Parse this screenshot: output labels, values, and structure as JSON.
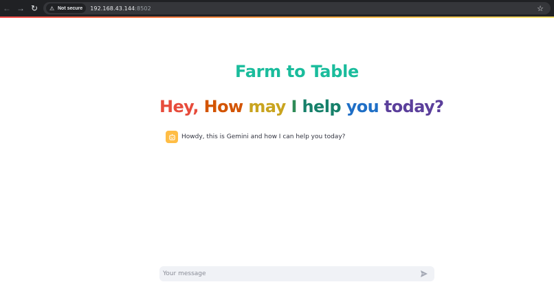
{
  "browser": {
    "back_icon": "arrow-left-icon",
    "forward_icon": "arrow-right-icon",
    "reload_icon": "reload-icon",
    "security_label": "Not secure",
    "url_host": "192.168.43.144",
    "url_port": ":8502",
    "bookmark_icon": "star-icon"
  },
  "app": {
    "title": "Farm to Table",
    "title_color": "#1abc9c",
    "headline_words": [
      {
        "text": "Hey,",
        "color": "#e74c3c"
      },
      {
        "text": "How",
        "color": "#d35400"
      },
      {
        "text": "may",
        "color": "#c9a41f"
      },
      {
        "text": "I",
        "color": "#2e8b57"
      },
      {
        "text": "help",
        "color": "#16806a"
      },
      {
        "text": "you",
        "color": "#1f6fc6"
      },
      {
        "text": "today?",
        "color": "#5b3f9b"
      }
    ],
    "assistant_avatar_icon": "robot-icon",
    "assistant_avatar_color": "#ffbd45",
    "assistant_message": "Howdy, this is Gemini and how I can help you today?"
  },
  "chat_input": {
    "placeholder": "Your message",
    "value": "",
    "send_icon": "send-icon"
  }
}
